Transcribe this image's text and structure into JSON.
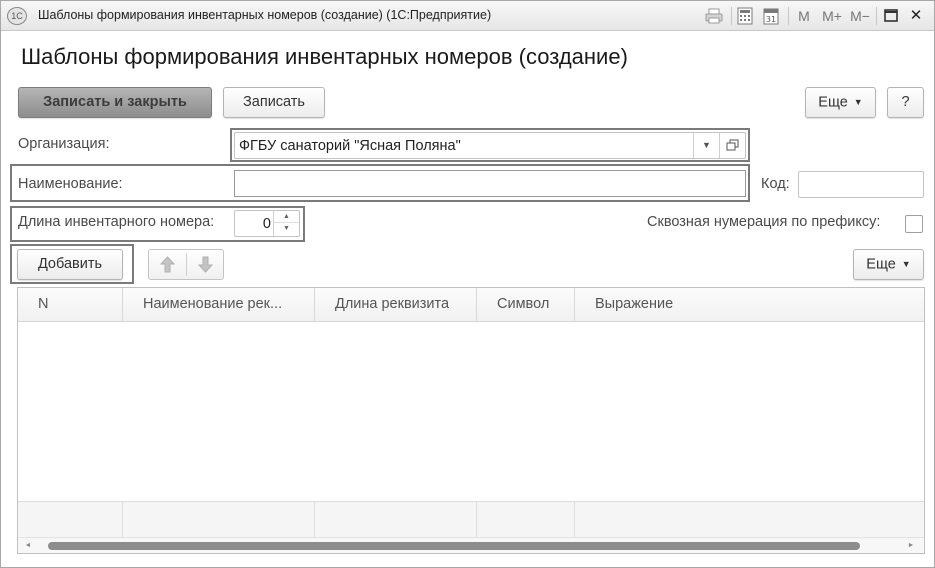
{
  "window": {
    "title": "Шаблоны формирования инвентарных номеров (создание)  (1С:Предприятие)",
    "logo_text": "1С",
    "toolbar_icons": [
      "print-icon",
      "calculator-icon",
      "calendar-icon",
      "memory-icon",
      "memory-plus-icon",
      "memory-minus-icon",
      "maximize-icon",
      "close-icon"
    ],
    "calendar_day": "31",
    "m_label": "M",
    "m_plus_label": "M+",
    "m_minus_label": "M−",
    "close_glyph": "✕"
  },
  "page": {
    "title": "Шаблоны формирования инвентарных номеров (создание)"
  },
  "toolbar": {
    "save_close_label": "Записать и закрыть",
    "save_label": "Записать",
    "more_label": "Еще",
    "help_label": "?"
  },
  "form": {
    "organization_label": "Организация:",
    "organization_value": "ФГБУ санаторий \"Ясная Поляна\"",
    "name_label": "Наименование:",
    "name_value": "",
    "code_label": "Код:",
    "code_value": "",
    "length_label": "Длина инвентарного номера:",
    "length_value": "0",
    "through_numbering_label": "Сквозная нумерация по префиксу:",
    "through_numbering_checked": false
  },
  "table_toolbar": {
    "add_label": "Добавить",
    "more_label": "Еще"
  },
  "table": {
    "columns": [
      "N",
      "Наименование рек...",
      "Длина реквизита",
      "Символ",
      "Выражение"
    ],
    "rows": []
  },
  "colors": {
    "primary_button": "#9f9f9f",
    "highlight_frame": "#7a7a7a"
  }
}
